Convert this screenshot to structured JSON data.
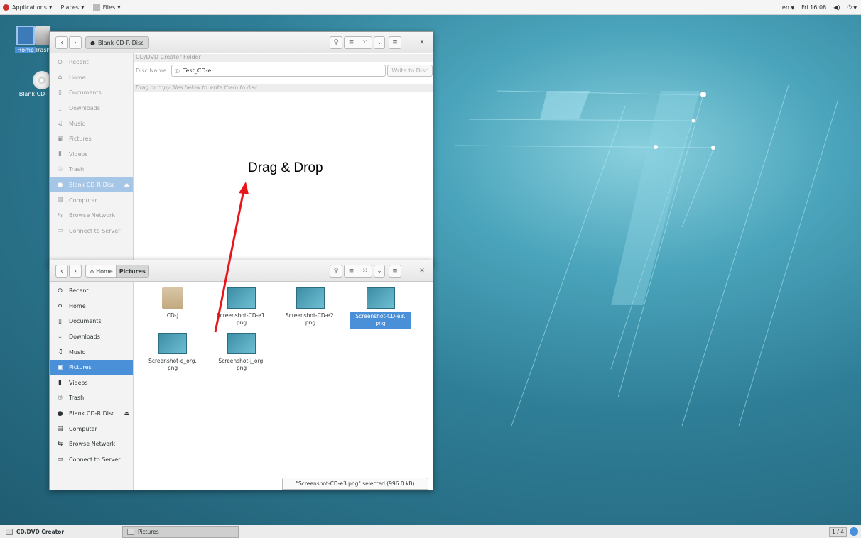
{
  "topbar": {
    "applications": "Applications",
    "places": "Places",
    "files": "Files",
    "lang": "en",
    "clock": "Fri 16:08"
  },
  "desktop": {
    "home": "Home",
    "trash": "Trash",
    "blankcd": "Blank CD-R Disc"
  },
  "cdwin": {
    "path": "Blank CD-R Disc",
    "folder_label": "CD/DVD Creator Folder",
    "disc_name_label": "Disc Name:",
    "disc_name_value": "Test_CD-e",
    "write_button": "Write to Disc",
    "hint": "Drag or copy files below to write them to disc",
    "sidebar": [
      "Recent",
      "Home",
      "Documents",
      "Downloads",
      "Music",
      "Pictures",
      "Videos",
      "Trash",
      "Blank CD-R Disc",
      "Computer",
      "Browse Network",
      "Connect to Server"
    ]
  },
  "picwin": {
    "path_home": "Home",
    "path_current": "Pictures",
    "sidebar": [
      "Recent",
      "Home",
      "Documents",
      "Downloads",
      "Music",
      "Pictures",
      "Videos",
      "Trash",
      "Blank CD-R Disc",
      "Computer",
      "Browse Network",
      "Connect to Server"
    ],
    "files": [
      {
        "l1": "CD-J",
        "l2": ""
      },
      {
        "l1": "Screenshot-CD-e1.",
        "l2": "png"
      },
      {
        "l1": "Screenshot-CD-e2.",
        "l2": "png"
      },
      {
        "l1": "Screenshot-CD-e3.",
        "l2": "png"
      },
      {
        "l1": "Screenshot-e_org.",
        "l2": "png"
      },
      {
        "l1": "Screenshot-j_org.",
        "l2": "png"
      }
    ],
    "status": "\"Screenshot-CD-e3.png\" selected (996.0 kB)"
  },
  "annotation": "Drag & Drop",
  "taskbar": {
    "task1": "CD/DVD Creator",
    "task2": "Pictures",
    "workspace": "1 / 4"
  },
  "colors": {
    "accent": "#4a90d9",
    "arrow": "#e8161b"
  }
}
